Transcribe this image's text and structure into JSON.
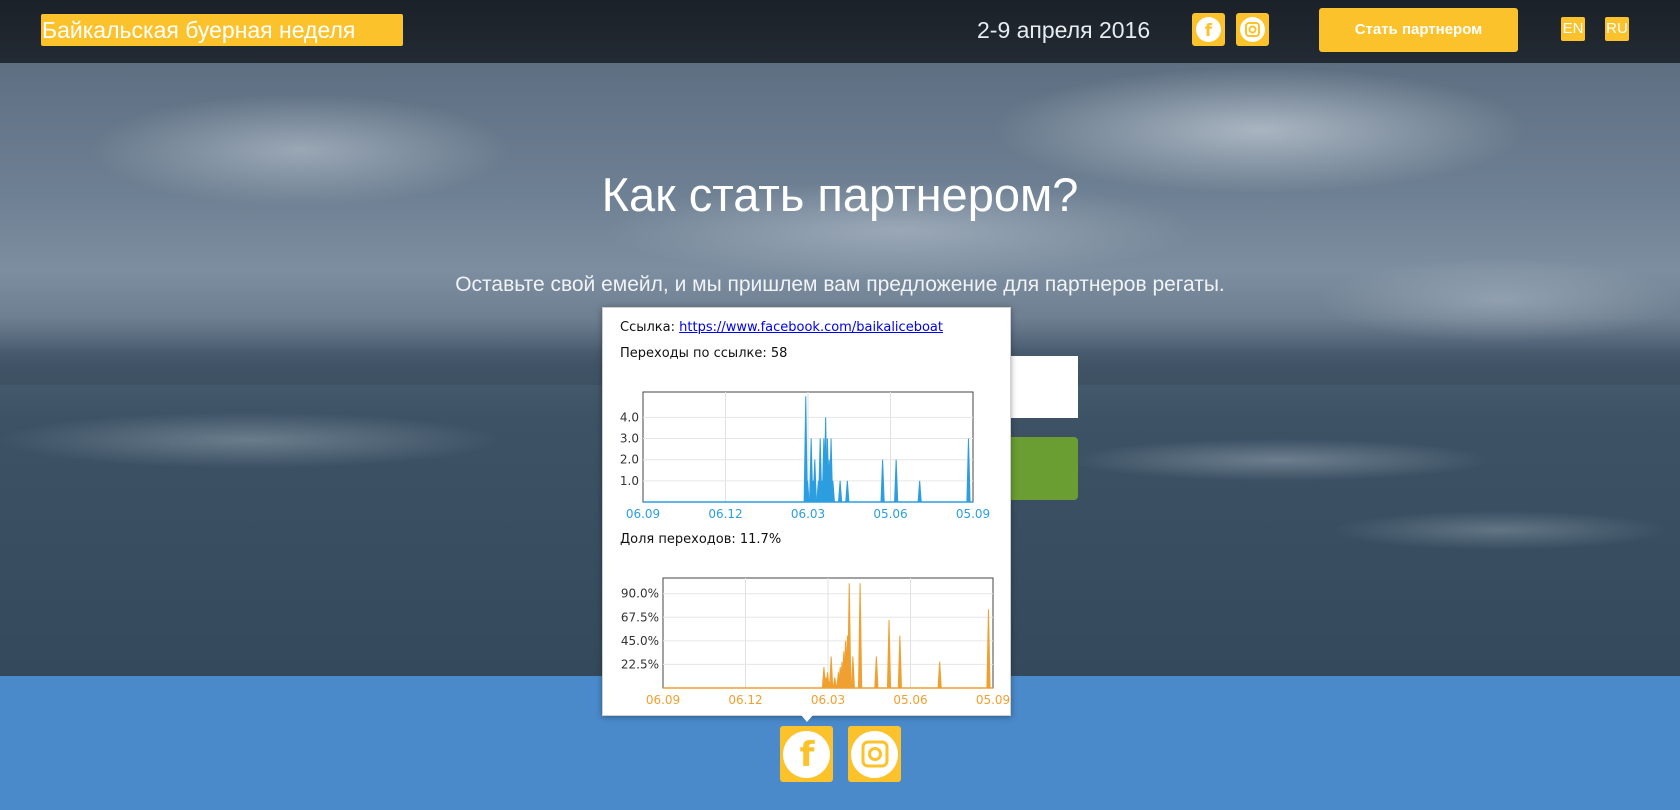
{
  "header": {
    "brand": "Байкальская буерная неделя",
    "dates": "2-9 апреля 2016",
    "cta_label": "Стать партнером",
    "lang_en": "EN",
    "lang_ru": "RU",
    "social_icons": [
      "facebook-icon",
      "instagram-icon"
    ]
  },
  "hero": {
    "title": "Как стать партнером?",
    "subtitle": "Оставьте свой емейл, и мы пришлем вам предложение для партнеров регаты."
  },
  "popup": {
    "link_label": "Ссылка:",
    "link_url": "https://www.facebook.com/baikaliceboat",
    "clicks_label": "Переходы по ссылке: 58",
    "share_label": "Доля переходов: 11.7%"
  },
  "colors": {
    "accent": "#fcc22b",
    "bottom_bar": "#4a8acb",
    "submit_green": "#6a9d32",
    "series_clicks": "#2d9ee0",
    "series_share": "#f0a030"
  },
  "chart_data": [
    {
      "type": "area",
      "x_ticks": [
        "06.09",
        "06.12",
        "06.03",
        "05.06",
        "05.09"
      ],
      "y_ticks": [
        "1.0",
        "2.0",
        "3.0",
        "4.0"
      ],
      "ylim": [
        0,
        5.2
      ],
      "x_range": [
        0,
        365
      ],
      "x": [
        180,
        182,
        184,
        186,
        188,
        190,
        192,
        194,
        196,
        198,
        200,
        202,
        204,
        206,
        208,
        210,
        218,
        226,
        265,
        280,
        306,
        360
      ],
      "values": [
        5,
        1,
        0,
        3,
        1,
        2,
        0,
        1,
        3,
        1,
        3,
        4,
        3,
        2,
        3,
        1,
        1,
        1,
        2,
        2,
        1,
        3
      ]
    },
    {
      "type": "area",
      "x_ticks": [
        "06.09",
        "06.12",
        "06.03",
        "05.06",
        "05.09"
      ],
      "y_ticks": [
        "22.5%",
        "45.0%",
        "67.5%",
        "90.0%"
      ],
      "ylim": [
        0,
        105
      ],
      "x_range": [
        0,
        365
      ],
      "x": [
        178,
        180,
        182,
        184,
        186,
        190,
        194,
        196,
        198,
        200,
        202,
        204,
        206,
        210,
        218,
        236,
        250,
        262,
        306,
        360
      ],
      "values": [
        20,
        10,
        15,
        5,
        30,
        10,
        15,
        20,
        25,
        35,
        45,
        50,
        100,
        30,
        100,
        30,
        65,
        50,
        25,
        75
      ]
    }
  ]
}
